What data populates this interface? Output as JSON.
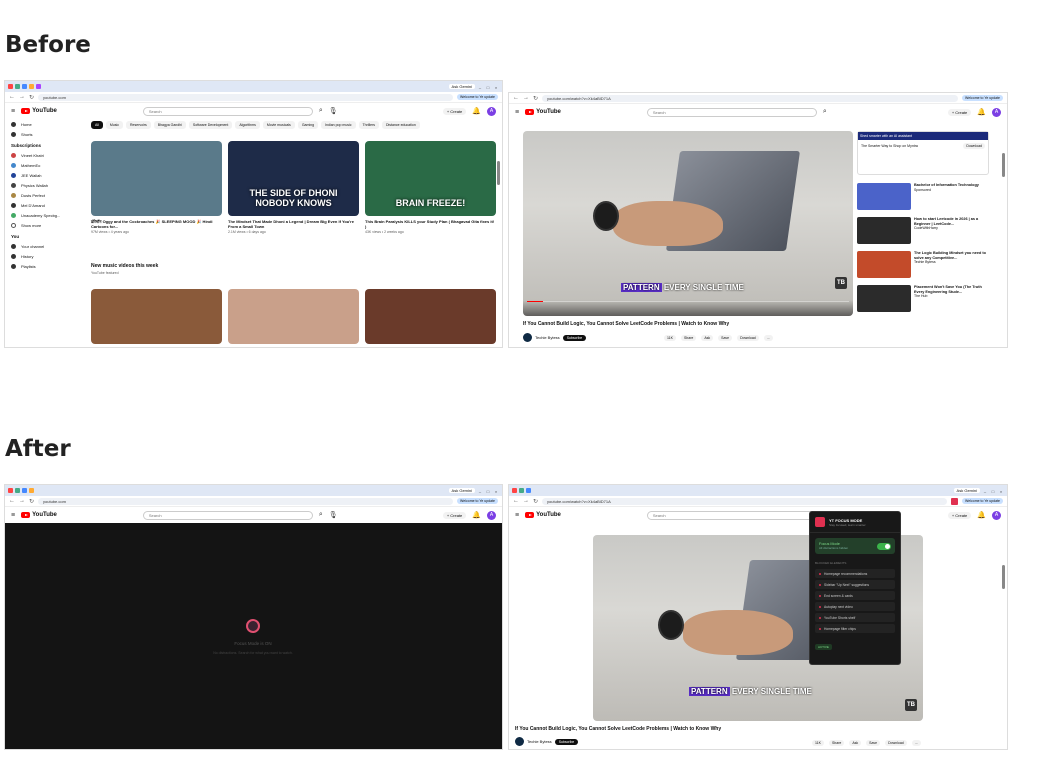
{
  "headings": {
    "before": "Before",
    "after": "After"
  },
  "browser": {
    "ask_gemini": "Ask Gemini",
    "pill": "Welcome to Ye update",
    "url_home": "youtube.com",
    "url_watch": "youtube.com/watch?v=Xk4aBlD71A"
  },
  "youtube": {
    "brand": "YouTube",
    "search_placeholder": "Search",
    "create": "Create",
    "avatar": "A"
  },
  "home": {
    "sidebar": {
      "top": [
        {
          "label": "Home"
        },
        {
          "label": "Shorts"
        }
      ],
      "subs_head": "Subscriptions",
      "subs": [
        "Vineet Khatri",
        "MathemEo",
        "JEE Wallah",
        "Physics Wallah",
        "Dusts Perfect",
        "Mel D'Amand",
        "Unacademy Specbg...",
        "Show more"
      ],
      "you_head": "You",
      "you": [
        "Your channel",
        "History",
        "Playlists"
      ]
    },
    "chips": [
      "All",
      "Music",
      "Reservoirs",
      "Bhagya Gandhi",
      "Software Development",
      "Algorithms",
      "Movie musicals",
      "Gaming",
      "Indian pop music",
      "Thrillers",
      "Distance education"
    ],
    "videos": [
      {
        "title": "डोरेमॉन Oggy and the Cockroaches 🎉 SLEEPING MOOD 🎉 Hindi Cartoons for...",
        "meta": "97M views • 4 years ago",
        "thumb_color": "#5a7a8a",
        "text": ""
      },
      {
        "title": "The Mindset That Made Dhoni a Legend | Dream Big Even If You're From a Small Town",
        "meta": "2.1M views • 6 days ago",
        "thumb_color": "#1e2b48",
        "text": "THE SIDE OF DHONI NOBODY KNOWS"
      },
      {
        "title": "This Brain Paralysis KILLS your Study Plan ( Bhagavad Gita fixes it! )",
        "meta": "43K views • 2 weeks ago",
        "thumb_color": "#2a6a46",
        "text": "BRAIN FREEZE!"
      }
    ],
    "section_title": "New music videos this week",
    "section_sub": "YouTube featured",
    "music_colors": [
      "#8a5a3a",
      "#c9a08a",
      "#6a3a2a"
    ]
  },
  "watch": {
    "caption_hl": "PATTERN",
    "caption_rest": " EVERY SINGLE TIME",
    "badge": "TB",
    "progress": 0.05,
    "title": "If You Cannot Build Logic, You Cannot Solve LeetCode Problems | Watch to Know Why",
    "channel": "Techie Bytess",
    "subscribe": "Subscribe",
    "actions": [
      "11K",
      "Share",
      "Ask",
      "Save",
      "Download",
      "..."
    ],
    "ad_title": "Shed smarter with an AI assistant",
    "ad_text": "The Smarter Way to Shop on Myntra",
    "ad_cta": "Download",
    "recs": [
      {
        "title": "Bachelor of Information Technology",
        "meta": "Sponsored",
        "color": "#4b63c9"
      },
      {
        "title": "How to start Leetcode in 2026 | as a Beginner | LeetCode...",
        "meta": "CodeWithHarry",
        "color": "#2a2a2a"
      },
      {
        "title": "The Logic Building Mindset you need to solve any Competitive...",
        "meta": "Techie Bytess",
        "color": "#c34b2a"
      },
      {
        "title": "Placement Won't Save You (The Truth Every Engineering Stude...",
        "meta": "The Hub",
        "color": "#2b2b2b"
      }
    ]
  },
  "focus": {
    "home_title": "Focus Mode is ON",
    "home_sub": "No distractions. Search for what you want to watch.",
    "panel_title": "YT FOCUS MODE",
    "panel_sub": "Stay focused, learn smarter",
    "mode_label": "Focus Mode",
    "mode_sub": "All distractions hidden",
    "hide_head": "BLOCKED ELEMENTS",
    "hidden": [
      "Homepage recommendations",
      "Sidebar \"Up Next\" suggestions",
      "End screen & cards",
      "Autoplay next video",
      "YouTube Shorts shelf",
      "Homepage filter chips"
    ],
    "status": "ACTIVE"
  }
}
